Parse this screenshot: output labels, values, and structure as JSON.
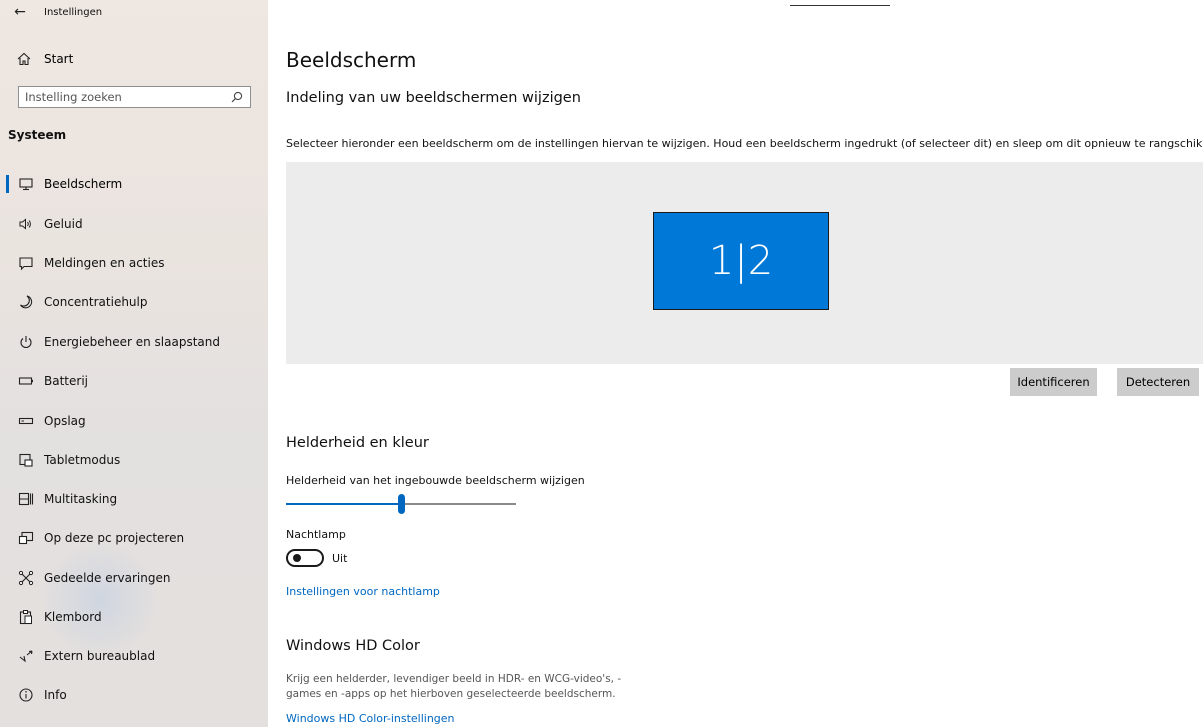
{
  "window": {
    "title": "Instellingen",
    "back_icon": "arrow-left-icon"
  },
  "sidebar": {
    "home_label": "Start",
    "search_placeholder": "Instelling zoeken",
    "section_title": "Systeem",
    "items": [
      {
        "label": "Beeldscherm",
        "icon": "monitor-icon",
        "active": true
      },
      {
        "label": "Geluid",
        "icon": "speaker-icon"
      },
      {
        "label": "Meldingen en acties",
        "icon": "notification-icon"
      },
      {
        "label": "Concentratiehulp",
        "icon": "moon-icon"
      },
      {
        "label": "Energiebeheer en slaapstand",
        "icon": "power-icon"
      },
      {
        "label": "Batterij",
        "icon": "battery-icon"
      },
      {
        "label": "Opslag",
        "icon": "storage-icon"
      },
      {
        "label": "Tabletmodus",
        "icon": "tablet-mode-icon"
      },
      {
        "label": "Multitasking",
        "icon": "multitasking-icon"
      },
      {
        "label": "Op deze pc projecteren",
        "icon": "project-icon"
      },
      {
        "label": "Gedeelde ervaringen",
        "icon": "shared-experiences-icon"
      },
      {
        "label": "Klembord",
        "icon": "clipboard-icon"
      },
      {
        "label": "Extern bureaublad",
        "icon": "remote-desktop-icon"
      },
      {
        "label": "Info",
        "icon": "info-icon"
      }
    ]
  },
  "main": {
    "title": "Beeldscherm",
    "arrange": {
      "heading": "Indeling van uw beeldschermen wijzigen",
      "description": "Selecteer hieronder een beeldscherm om de instellingen hiervan te wijzigen. Houd een beeldscherm ingedrukt (of selecteer dit) en sleep om dit opnieuw te rangschikken.",
      "monitor_label": "1|2",
      "identify_button": "Identificeren",
      "detect_button": "Detecteren"
    },
    "brightness": {
      "heading": "Helderheid en kleur",
      "slider_label": "Helderheid van het ingebouwde beeldscherm wijzigen",
      "slider_value_fraction": 0.5,
      "night_light_label": "Nachtlamp",
      "night_light_state": "Uit",
      "night_light_on": false,
      "night_light_link": "Instellingen voor nachtlamp"
    },
    "hdr": {
      "heading": "Windows HD Color",
      "description_line1": "Krijg een helderder, levendiger beeld in HDR- en WCG-video's, -",
      "description_line2": "games en -apps op het hierboven geselecteerde beeldscherm.",
      "link": "Windows HD Color-instellingen"
    }
  },
  "colors": {
    "accent": "#0067c0",
    "monitor": "#0078d7",
    "button_bg": "#cccccc"
  }
}
